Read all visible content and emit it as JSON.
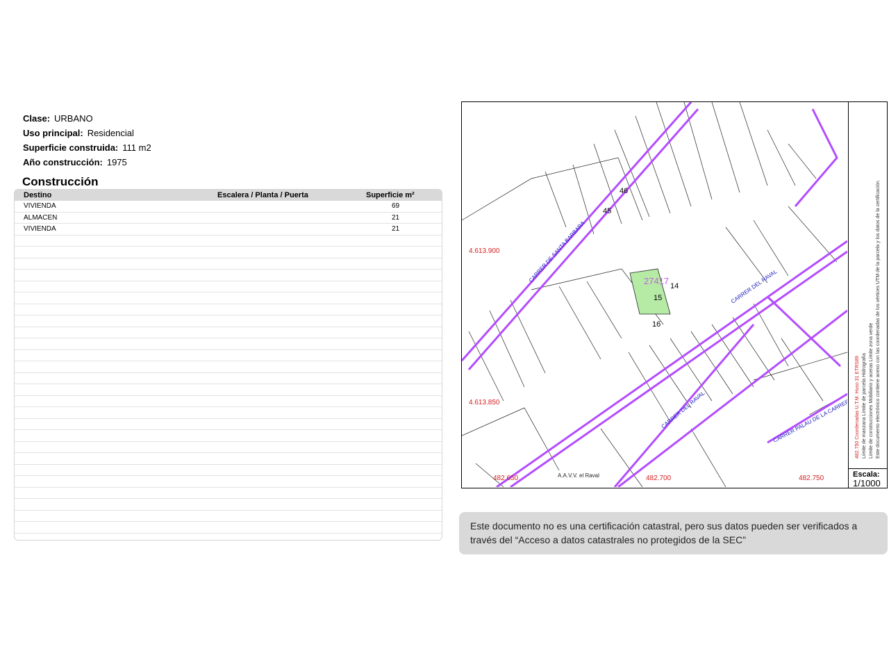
{
  "info": {
    "clase_label": "Clase:",
    "clase_value": "URBANO",
    "uso_label": "Uso principal:",
    "uso_value": "Residencial",
    "superficie_label": "Superficie construida:",
    "superficie_value": "111 m2",
    "anio_label": "Año construcción:",
    "anio_value": "1975"
  },
  "construccion": {
    "title": "Construcción",
    "headers": [
      "Destino",
      "Escalera / Planta / Puerta",
      "Superficie m²"
    ],
    "rows": [
      {
        "destino": "VIVIENDA",
        "escalera": "",
        "superficie": "69"
      },
      {
        "destino": "ALMACEN",
        "escalera": "",
        "superficie": "21"
      },
      {
        "destino": "VIVIENDA",
        "escalera": "",
        "superficie": "21"
      }
    ]
  },
  "map": {
    "parcel_ref": "27417",
    "parcel_numbers": [
      "14",
      "15",
      "16",
      "45",
      "46"
    ],
    "coords": [
      "4.613.900",
      "4.613.850",
      "482.650",
      "482.700",
      "482.750"
    ],
    "streets": [
      "CARRER DE SANTA BARBARA",
      "CARRER DEL RAVAL",
      "CARRER DEL RAVAL",
      "CARRER PALAU DE LA CARRERA"
    ],
    "aavv_label": "A.A.V.V. el Raval",
    "legend": {
      "line1": "482.750 Coordenadas U.T.M. Huso 31 ETRS89",
      "line2": "Límite de manzana   Límite de parcela   Hidrografía",
      "line3": "Límite de construcciones   Mobiliario y aceras   Límite zona verde",
      "line4": "Este documento electrónico contiene anexo con las coordenadas de los vértices UTM de la parcela y los datos de la certificación."
    },
    "scale_label": "Escala:",
    "scale_value": "1/1000"
  },
  "notice": {
    "text": "Este documento no es una certificación catastral, pero sus datos pueden ser verificados a través del “Acceso a datos catastrales no protegidos de la SEC”"
  }
}
